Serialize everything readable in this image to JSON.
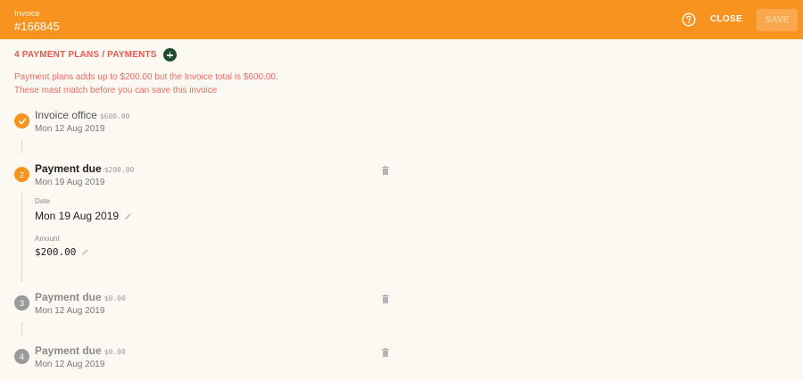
{
  "header": {
    "invoice_label": "Invoice",
    "invoice_number": "#166845",
    "help_icon": "help-circle-icon",
    "close_label": "CLOSE",
    "save_label": "SAVE"
  },
  "section": {
    "title": "4 PAYMENT PLANS / PAYMENTS",
    "add_icon": "plus-circle-icon"
  },
  "warning": {
    "line1": "Payment plans adds up to $200.00 but the Invoice total is $600.00.",
    "line2": "These mast match before you can save this invoice"
  },
  "steps": [
    {
      "badge": "",
      "badge_icon": "check-icon",
      "title": "Invoice office",
      "amount": "$600.00",
      "date": "Mon 12 Aug 2019"
    },
    {
      "badge": "2",
      "title": "Payment due",
      "amount": "$200.00",
      "date": "Mon 19 Aug 2019",
      "date_label": "Date",
      "date_value": "Mon 19 Aug 2019",
      "amount_label": "Amount",
      "amount_value": "$200.00"
    },
    {
      "badge": "3",
      "title": "Payment due",
      "amount": "$0.00",
      "date": "Mon 12 Aug 2019"
    },
    {
      "badge": "4",
      "title": "Payment due",
      "amount": "$0.00",
      "date": "Mon 12 Aug 2019"
    }
  ],
  "colors": {
    "header_bg": "#f7931e",
    "error_text": "#e85a4f",
    "add_button": "#1c4d2e",
    "active_badge": "#f7931e",
    "inactive_badge": "#9a9a9a"
  }
}
